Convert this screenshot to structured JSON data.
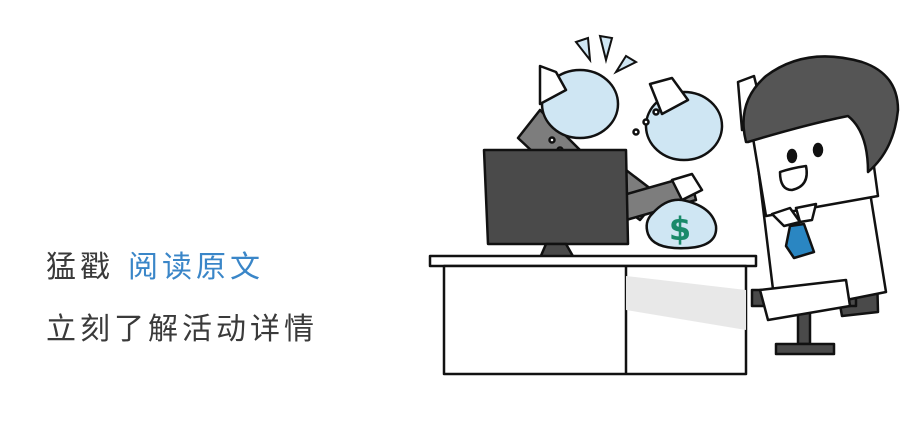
{
  "promo": {
    "prefix": "猛戳",
    "link_text": "阅读原文",
    "subtitle": "立刻了解活动详情"
  },
  "colors": {
    "text": "#3a3a3a",
    "link": "#3a86c8",
    "bag": "#cfe6f3",
    "dollar": "#1a8a6a",
    "tie": "#2a86c2"
  },
  "illustration": {
    "money_bag_symbol": "$"
  }
}
